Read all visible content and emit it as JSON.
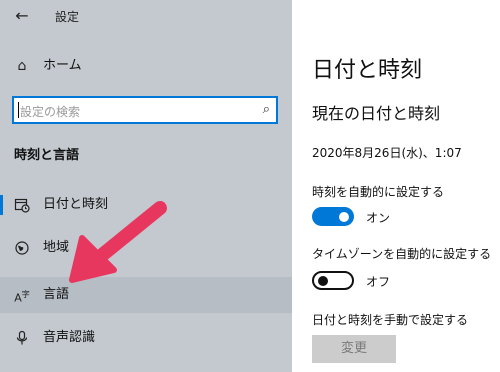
{
  "app": {
    "title": "設定"
  },
  "sidebar": {
    "home_label": "ホーム",
    "search_placeholder": "設定の検索",
    "section_title": "時刻と言語",
    "items": [
      {
        "label": "日付と時刻",
        "icon": "calendar-clock-icon"
      },
      {
        "label": "地域",
        "icon": "globe-icon"
      },
      {
        "label": "言語",
        "icon": "language-icon"
      },
      {
        "label": "音声認識",
        "icon": "microphone-icon"
      }
    ]
  },
  "main": {
    "page_title": "日付と時刻",
    "sub_title": "現在の日付と時刻",
    "current_datetime": "2020年8月26日(水)、1:07",
    "auto_time": {
      "label": "時刻を自動的に設定する",
      "state": "オン",
      "on": true
    },
    "auto_timezone": {
      "label": "タイムゾーンを自動的に設定する",
      "state": "オフ",
      "on": false
    },
    "manual": {
      "label": "日付と時刻を手動で設定する",
      "button": "変更"
    }
  },
  "colors": {
    "accent": "#0078d7",
    "sidebar_bg": "#c3c9cf",
    "arrow": "#ee3d6a"
  }
}
